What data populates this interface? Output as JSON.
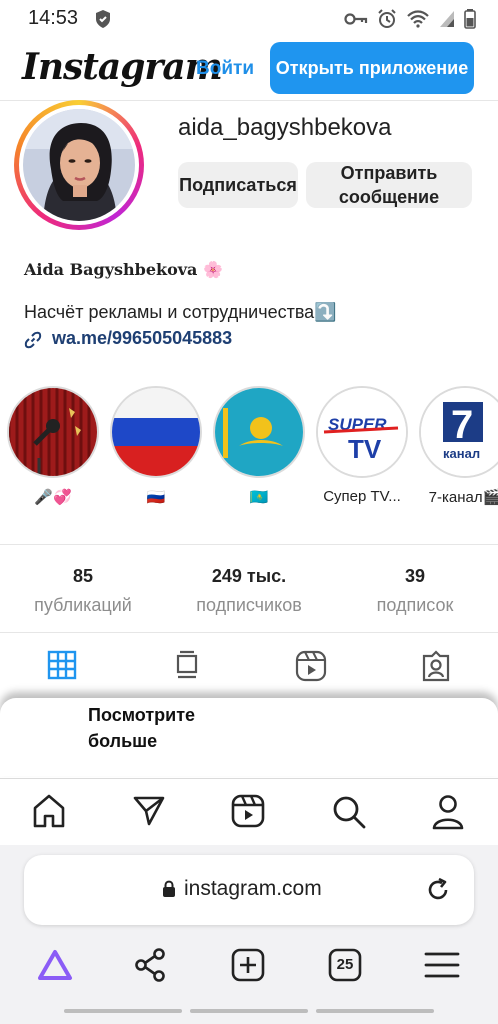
{
  "status": {
    "time": "14:53"
  },
  "header": {
    "logo": "Instagram",
    "login": "Войти",
    "open_app": "Открыть приложение"
  },
  "profile": {
    "username": "aida_bagyshbekova",
    "subscribe": "Подписаться",
    "message": "Отправить сообщение",
    "full_name": "Aida Bagyshbekova 🌸",
    "bio": "Насчёт рекламы и сотрудничества⤵️",
    "link": "wa.me/996505045883"
  },
  "highlights": [
    {
      "label": "🎤💞"
    },
    {
      "label": "🇷🇺"
    },
    {
      "label": "🇰🇿"
    },
    {
      "label": "Супер TV..."
    },
    {
      "label": "7-канал🎬"
    }
  ],
  "highlight_text": {
    "super": "SUPER",
    "tv": "TV",
    "seven": "7",
    "seven_sub": "канал"
  },
  "stats": [
    {
      "value": "85",
      "label": "публикаций"
    },
    {
      "value": "249 тыс.",
      "label": "подписчиков"
    },
    {
      "value": "39",
      "label": "подписок"
    }
  ],
  "sheet": {
    "see_more": "Посмотрите больше"
  },
  "browser": {
    "url": "instagram.com",
    "tabs_count": "25"
  },
  "colors": {
    "accent": "#1f95ef",
    "link": "#1e3f73",
    "alice": "#8b5cf6"
  }
}
